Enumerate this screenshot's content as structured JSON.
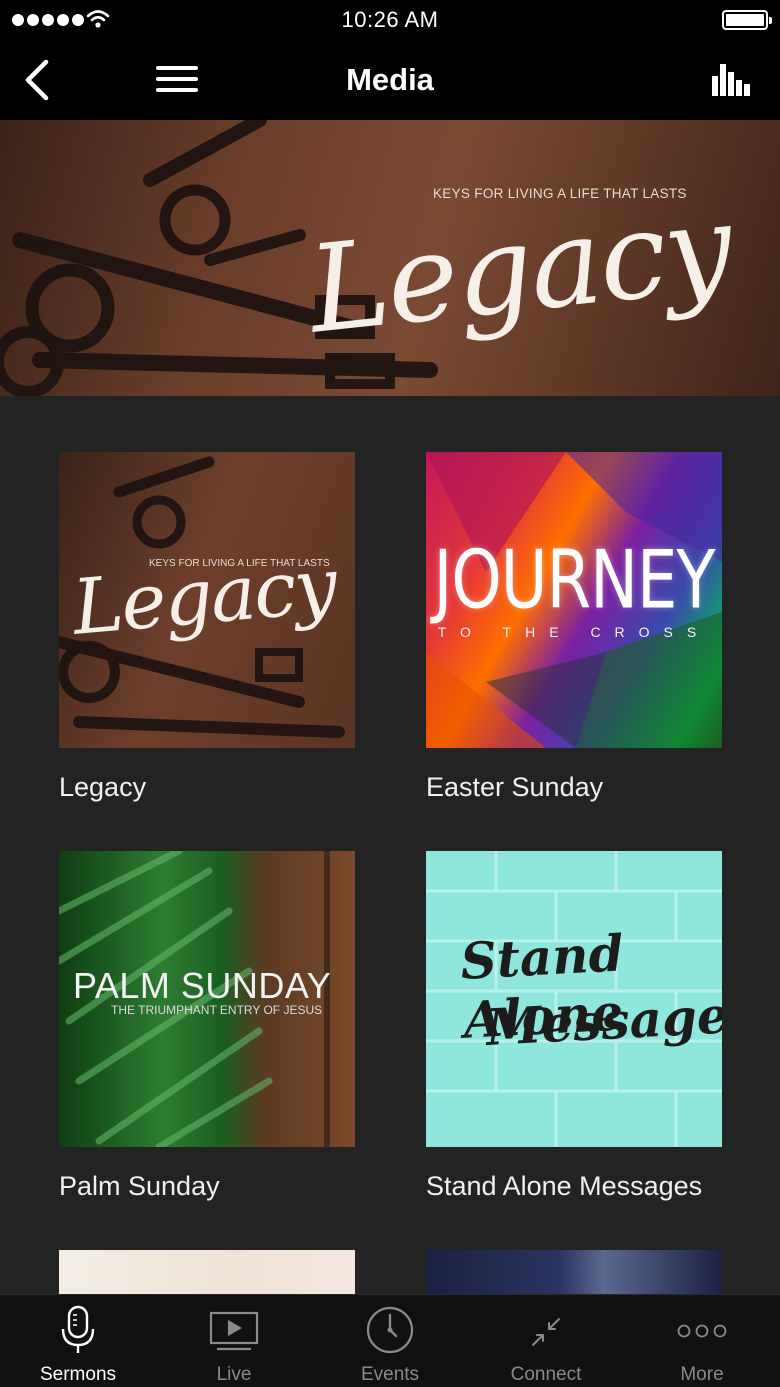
{
  "status_bar": {
    "time": "10:26 AM"
  },
  "nav": {
    "title": "Media"
  },
  "banner": {
    "tagline": "KEYS FOR LIVING A LIFE THAT LASTS",
    "title": "Legacy"
  },
  "grid": {
    "items": [
      {
        "label": "Legacy",
        "art_tagline": "KEYS FOR LIVING A LIFE THAT LASTS",
        "art_title": "Legacy"
      },
      {
        "label": "Easter Sunday",
        "art_title": "JOURNEY",
        "art_sub": "TO THE CROSS"
      },
      {
        "label": "Palm Sunday",
        "art_title": "PALM SUNDAY",
        "art_sub": "THE TRIUMPHANT ENTRY OF JESUS"
      },
      {
        "label": "Stand Alone Messages",
        "art_line1": "Stand Alone",
        "art_line2": "Messages"
      }
    ]
  },
  "tabs": [
    {
      "label": "Sermons",
      "icon": "microphone-icon",
      "active": true
    },
    {
      "label": "Live",
      "icon": "play-screen-icon",
      "active": false
    },
    {
      "label": "Events",
      "icon": "clock-icon",
      "active": false
    },
    {
      "label": "Connect",
      "icon": "connect-arrows-icon",
      "active": false
    },
    {
      "label": "More",
      "icon": "more-dots-icon",
      "active": false
    }
  ],
  "colors": {
    "background": "#232323",
    "bars": "#000000",
    "tab_active": "#ffffff",
    "tab_inactive": "#8a8a8a"
  }
}
